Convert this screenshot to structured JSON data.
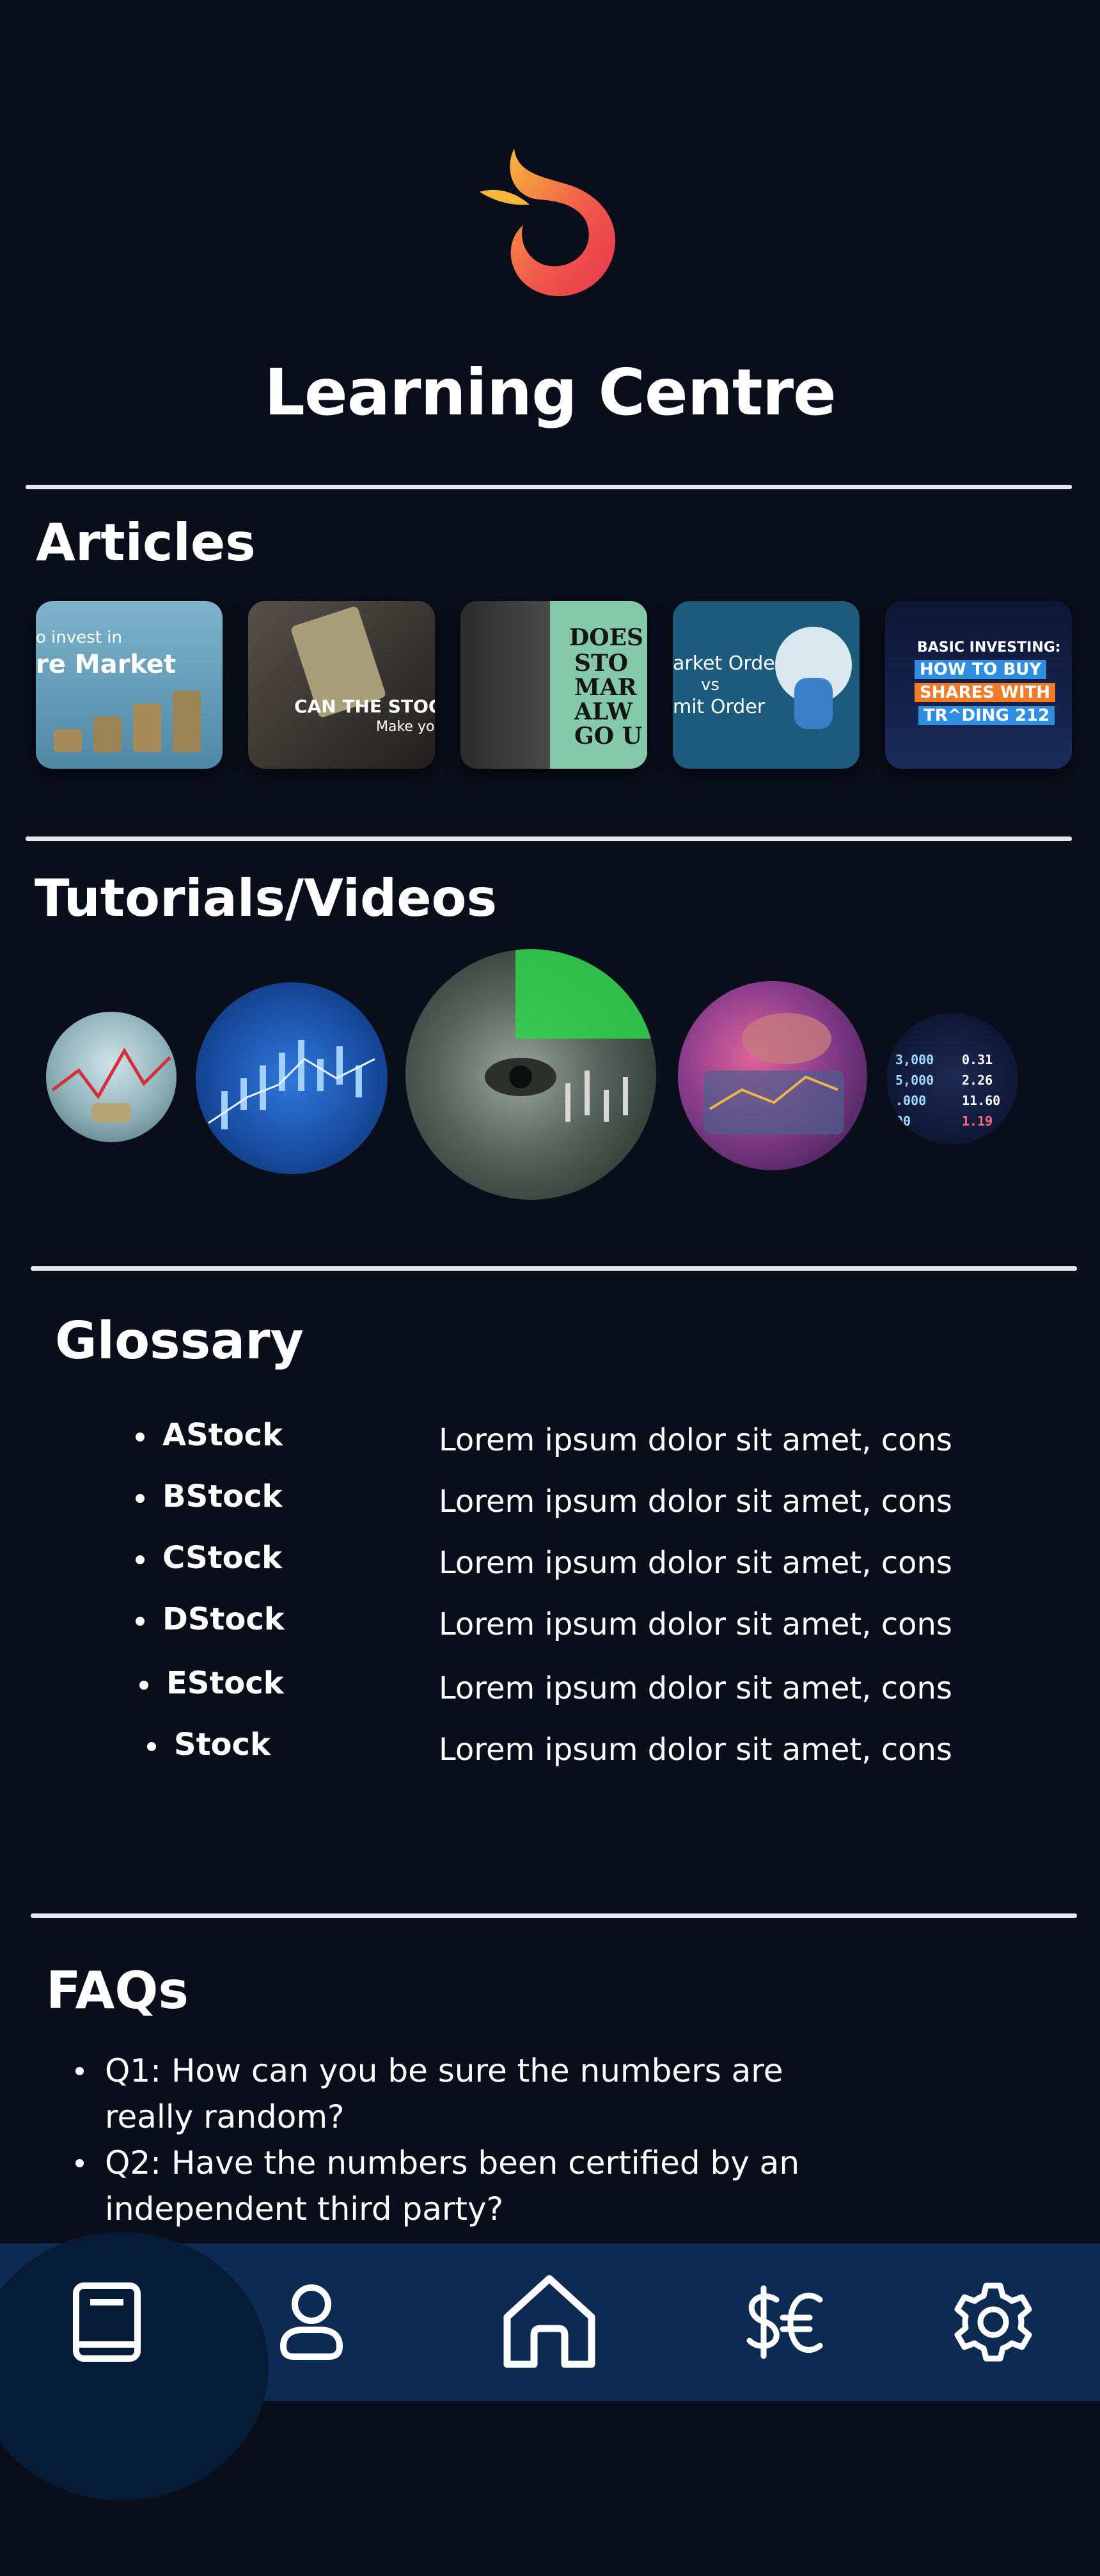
{
  "header": {
    "logo_icon": "flame-logo-icon",
    "title": "Learning Centre"
  },
  "articles": {
    "title": "Articles",
    "cards": [
      {
        "caption": "o invest in",
        "caption2": "re Market",
        "bg": "#5e95b2"
      },
      {
        "caption": "CAN THE STOCK MA",
        "caption2": "Make yo",
        "bg": "#2d2a26"
      },
      {
        "caption": "DOES",
        "caption2": "STO\nMAR\nALW\nGO U",
        "bg": "#86c8aa"
      },
      {
        "caption": "arket Order",
        "caption2": "vs",
        "caption3": "mit Order",
        "bg": "#1d5b7c"
      },
      {
        "caption": "BASIC INVESTING:",
        "caption2": "HOW TO BUY",
        "caption3": "SHARES WITH",
        "caption4": "TR^DING 212",
        "bg": "#101a3a"
      }
    ]
  },
  "tutorials": {
    "title": "Tutorials/Videos",
    "videos": [
      {
        "name": "video-coins-chart",
        "colors": [
          "#a9c9d0",
          "#5f8a96"
        ]
      },
      {
        "name": "video-blue-candles",
        "colors": [
          "#2a67c9",
          "#0a2e70"
        ]
      },
      {
        "name": "video-dollar-bill",
        "colors": [
          "#6e7a76",
          "#1c2520"
        ]
      },
      {
        "name": "video-trading-screen",
        "colors": [
          "#b23f6e",
          "#2a1b4a"
        ]
      },
      {
        "name": "video-stock-ticker",
        "colors": [
          "#1e2a50",
          "#0a0e1a"
        ]
      }
    ]
  },
  "glossary": {
    "title": "Glossary",
    "items": [
      {
        "term": "AStock",
        "definition": "Lorem ipsum dolor sit amet, cons"
      },
      {
        "term": "BStock",
        "definition": "Lorem ipsum dolor sit amet, cons"
      },
      {
        "term": "CStock",
        "definition": "Lorem ipsum dolor sit amet, cons"
      },
      {
        "term": "DStock",
        "definition": "Lorem ipsum dolor sit amet, cons"
      },
      {
        "term": "EStock",
        "definition": "Lorem ipsum dolor sit amet, cons"
      },
      {
        "term": "Stock",
        "definition": "Lorem ipsum dolor sit amet, cons"
      }
    ]
  },
  "faqs": {
    "title": "FAQs",
    "items": [
      "Q1: How can you be sure the numbers are really random?",
      "Q2: Have the numbers been certified by an independent third party?"
    ]
  },
  "nav": {
    "items": [
      "book-icon",
      "user-icon",
      "home-icon",
      "currency-icon",
      "gear-icon"
    ],
    "active": "book-icon"
  },
  "colors": {
    "background": "#0a0e1a",
    "nav_bar": "#0c2a52",
    "nav_active": "#061b36",
    "logo_gradient": [
      "#f6b73c",
      "#e8364f"
    ]
  }
}
